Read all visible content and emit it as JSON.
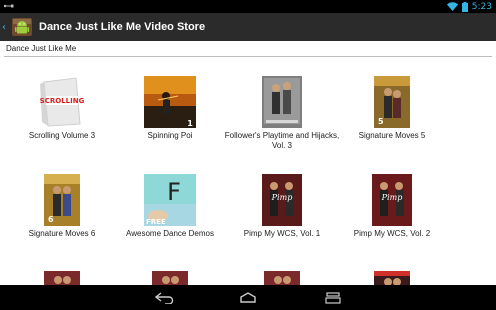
{
  "status_bar": {
    "time": "5:23",
    "icons": [
      "usb-icon",
      "wifi-icon",
      "battery-icon"
    ],
    "accent_color": "#33b5e5"
  },
  "action_bar": {
    "title": "Dance Just Like Me Video Store",
    "app_icon": "android-icon",
    "up_icon": "back-caret-icon"
  },
  "section": {
    "title": "Dance Just Like Me"
  },
  "videos": [
    {
      "label": "Scrolling Volume 3",
      "cover_text": "SCROLLING"
    },
    {
      "label": "Spinning Poi",
      "cover_text": "1"
    },
    {
      "label": "Follower's Playtime and Hijacks, Vol. 3"
    },
    {
      "label": "Signature Moves 5",
      "cover_text": "5"
    },
    {
      "label": "Signature Moves 6",
      "cover_text": "6"
    },
    {
      "label": "Awesome Dance Demos",
      "cover_text": "F",
      "badge": "FREE"
    },
    {
      "label": "Pimp My WCS, Vol. 1",
      "cover_text": "Pimp"
    },
    {
      "label": "Pimp My WCS, Vol. 2",
      "cover_text": "Pimp"
    }
  ],
  "nav_bar": {
    "buttons": [
      "back-icon",
      "home-icon",
      "recent-apps-icon"
    ]
  }
}
